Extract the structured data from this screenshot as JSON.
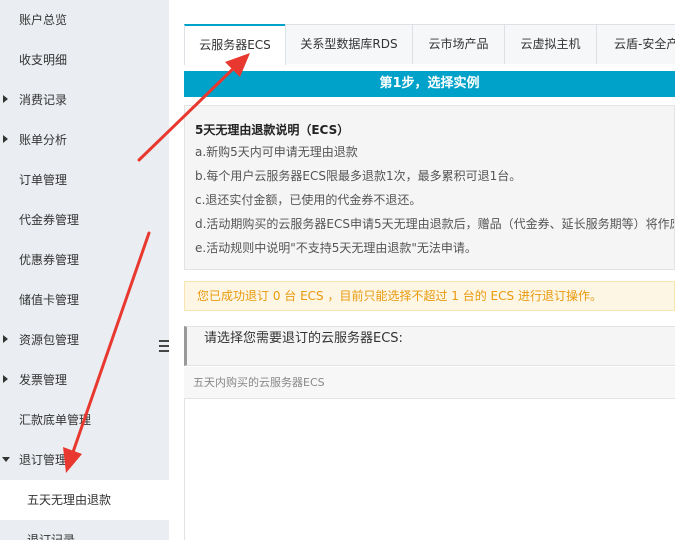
{
  "sidebar": {
    "items": [
      {
        "label": "账户总览",
        "caret": "none"
      },
      {
        "label": "收支明细",
        "caret": "none"
      },
      {
        "label": "消费记录",
        "caret": "right"
      },
      {
        "label": "账单分析",
        "caret": "right"
      },
      {
        "label": "订单管理",
        "caret": "none"
      },
      {
        "label": "代金券管理",
        "caret": "none"
      },
      {
        "label": "优惠券管理",
        "caret": "none"
      },
      {
        "label": "储值卡管理",
        "caret": "none"
      },
      {
        "label": "资源包管理",
        "caret": "right"
      },
      {
        "label": "发票管理",
        "caret": "right"
      },
      {
        "label": "汇款底单管理",
        "caret": "none"
      },
      {
        "label": "退订管理",
        "caret": "down"
      },
      {
        "label": "五天无理由退款",
        "caret": "sub-active"
      },
      {
        "label": "退订记录",
        "caret": "sub"
      }
    ],
    "collapse_icon": "menu-collapse-icon"
  },
  "tabs": [
    {
      "label": "云服务器ECS",
      "active": true
    },
    {
      "label": "关系型数据库RDS",
      "active": false
    },
    {
      "label": "云市场产品",
      "active": false
    },
    {
      "label": "云虚拟主机",
      "active": false
    },
    {
      "label": "云盾-安全产",
      "active": false
    }
  ],
  "step": {
    "label": "第1步，选择实例"
  },
  "notice": {
    "title": "5天无理由退款说明（ECS）",
    "lines": [
      "a.新购5天内可申请无理由退款",
      "b.每个用户云服务器ECS限最多退款1次，最多累积可退1台。",
      "c.退还实付金额，已使用的代金券不退还。",
      "d.活动期购买的云服务器ECS申请5天无理由退款后，赠品（代金券、延长服务期等）将作废",
      "e.活动规则中说明\"不支持5天无理由退款\"无法申请。"
    ]
  },
  "warning": {
    "text": "您已成功退订 0 台 ECS ，目前只能选择不超过 1 台的 ECS 进行退订操作。"
  },
  "select_section": {
    "title": "请选择您需要退订的云服务器ECS:"
  },
  "list": {
    "header": "五天内购买的云服务器ECS"
  },
  "colors": {
    "accent": "#00a2ca",
    "sidebar_bg": "#eaedf1",
    "warning_text": "#e89a0c",
    "annotation": "#e8382f"
  }
}
